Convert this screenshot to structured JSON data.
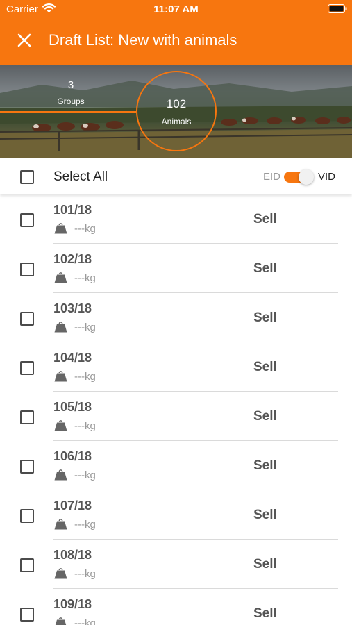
{
  "status_bar": {
    "carrier": "Carrier",
    "time": "11:07 AM"
  },
  "header": {
    "title": "Draft List: New with animals"
  },
  "summary": {
    "groups": {
      "count": "3",
      "label": "Groups"
    },
    "animals": {
      "count": "102",
      "label": "Animals"
    }
  },
  "select_bar": {
    "select_all_label": "Select All",
    "eid_label": "EID",
    "vid_label": "VID",
    "toggle_on": true
  },
  "animals": [
    {
      "id": "101/18",
      "weight": "---kg",
      "action": "Sell"
    },
    {
      "id": "102/18",
      "weight": "---kg",
      "action": "Sell"
    },
    {
      "id": "103/18",
      "weight": "---kg",
      "action": "Sell"
    },
    {
      "id": "104/18",
      "weight": "---kg",
      "action": "Sell"
    },
    {
      "id": "105/18",
      "weight": "---kg",
      "action": "Sell"
    },
    {
      "id": "106/18",
      "weight": "---kg",
      "action": "Sell"
    },
    {
      "id": "107/18",
      "weight": "---kg",
      "action": "Sell"
    },
    {
      "id": "108/18",
      "weight": "---kg",
      "action": "Sell"
    },
    {
      "id": "109/18",
      "weight": "---kg",
      "action": "Sell"
    }
  ],
  "colors": {
    "accent": "#F7760F",
    "text_dark": "#555555",
    "text_muted": "#9A9A9A"
  },
  "icons": {
    "close": "close-icon",
    "wifi": "wifi-icon",
    "battery": "battery-icon",
    "weight": "weight-icon",
    "checkbox": "checkbox-icon"
  }
}
